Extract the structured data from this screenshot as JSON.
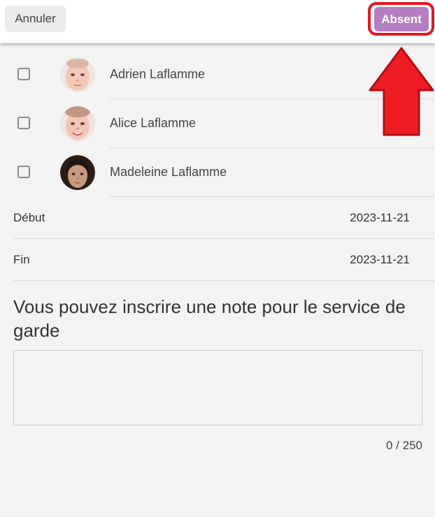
{
  "header": {
    "cancel_label": "Annuler",
    "absent_label": "Absent"
  },
  "children": [
    {
      "name": "Adrien Laflamme",
      "checked": false
    },
    {
      "name": "Alice Laflamme",
      "checked": false
    },
    {
      "name": "Madeleine Laflamme",
      "checked": false
    }
  ],
  "dates": {
    "start_label": "Début",
    "start_value": "2023-11-21",
    "end_label": "Fin",
    "end_value": "2023-11-21"
  },
  "note": {
    "heading": "Vous pouvez inscrire une note pour le service de garde",
    "value": "",
    "char_count": "0 / 250"
  },
  "colors": {
    "accent": "#b47fc0",
    "highlight": "#e8141f",
    "background": "#f3f3f3"
  },
  "annotation": {
    "icon": "up-arrow-icon"
  }
}
